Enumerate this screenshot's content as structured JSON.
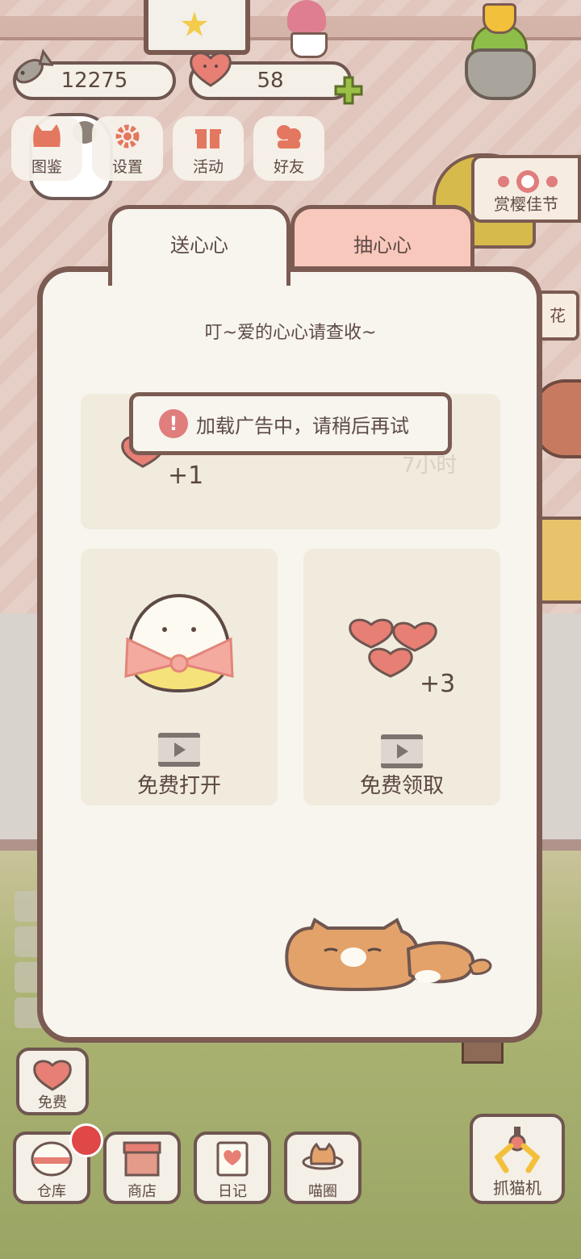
{
  "currency": {
    "fish": "12275",
    "hearts": "58"
  },
  "top_menu": [
    {
      "label": "图鉴",
      "icon": "cat-face-icon"
    },
    {
      "label": "设置",
      "icon": "gear-icon"
    },
    {
      "label": "活动",
      "icon": "gift-icon"
    },
    {
      "label": "好友",
      "icon": "friends-icon"
    }
  ],
  "event_sign": {
    "label": "赏樱佳节"
  },
  "side_sign_text": "花",
  "dialog": {
    "tabs": [
      {
        "label": "送心心",
        "active": true
      },
      {
        "label": "抽心心",
        "active": false
      }
    ],
    "title": "叮~爱的心心请查收~",
    "timed_reward": {
      "amount": "+1",
      "timer": "7小时"
    },
    "free_open": {
      "label": "免费打开"
    },
    "free_claim": {
      "label": "免费领取",
      "amount": "+3"
    }
  },
  "toast": {
    "message": "加载广告中，请稍后再试"
  },
  "bottom": {
    "free": {
      "label": "免费"
    },
    "items": [
      {
        "label": "仓库"
      },
      {
        "label": "商店"
      },
      {
        "label": "日记"
      },
      {
        "label": "喵圈"
      }
    ],
    "claw": {
      "label": "抓猫机"
    }
  },
  "colors": {
    "border": "#7b5b52",
    "panel": "#f7f5ee",
    "card": "#f1ebdd",
    "inactive_tab": "#f9c8bc",
    "heart": "#e77f74",
    "alert": "#e04747"
  }
}
